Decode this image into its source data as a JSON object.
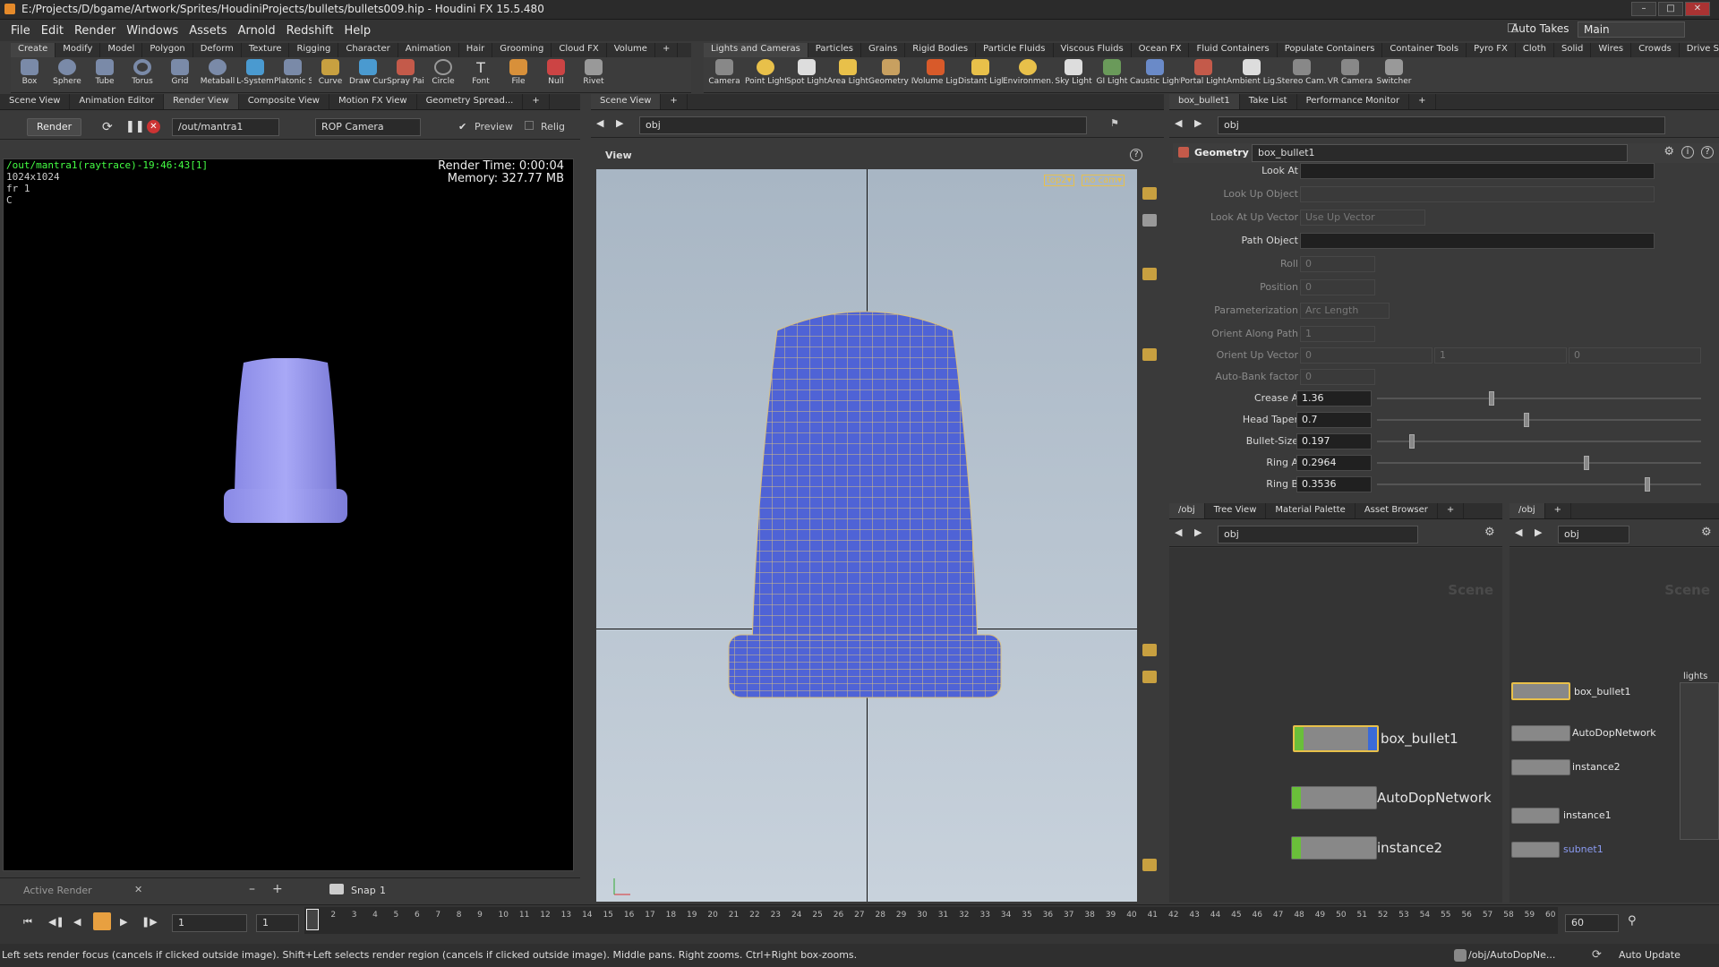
{
  "window": {
    "title": "E:/Projects/D/bgame/Artwork/Sprites/HoudiniProjects/bullets/bullets009.hip - Houdini FX 15.5.480"
  },
  "menu": [
    "File",
    "Edit",
    "Render",
    "Windows",
    "Assets",
    "Arnold",
    "Redshift",
    "Help"
  ],
  "top_right": {
    "auto_takes": "Auto Takes",
    "desktop": "Main"
  },
  "shelf_left": {
    "tabs": [
      "Create",
      "Modify",
      "Model",
      "Polygon",
      "Deform",
      "Texture",
      "Rigging",
      "Character",
      "Animation",
      "Hair",
      "Grooming",
      "Cloud FX",
      "Volume"
    ],
    "tools": [
      "Box",
      "Sphere",
      "Tube",
      "Torus",
      "Grid",
      "Metaball",
      "L-System",
      "Platonic Sol...",
      "Curve",
      "Draw Curve",
      "Spray Paint",
      "Circle",
      "Font",
      "File",
      "Null",
      "Rivet"
    ]
  },
  "shelf_right": {
    "tabs": [
      "Lights and Cameras",
      "Particles",
      "Grains",
      "Rigid Bodies",
      "Particle Fluids",
      "Viscous Fluids",
      "Ocean FX",
      "Fluid Containers",
      "Populate Containers",
      "Container Tools",
      "Pyro FX",
      "Cloth",
      "Solid",
      "Wires",
      "Crowds",
      "Drive Simulation"
    ],
    "tools": [
      "Camera",
      "Point Light",
      "Spot Light",
      "Area Light",
      "Geometry L...",
      "Volume Light",
      "Distant Light",
      "Environmen...",
      "Sky Light",
      "GI Light",
      "Caustic Light",
      "Portal Light",
      "Ambient Lig...",
      "Stereo Cam...",
      "VR Camera",
      "Switcher"
    ]
  },
  "left_panel": {
    "tabs": [
      "Scene View",
      "Animation Editor",
      "Render View",
      "Composite View",
      "Motion FX View",
      "Geometry Spread..."
    ],
    "render_btn": "Render",
    "rop_path": "/out/mantra1",
    "camera": "ROP Camera",
    "preview": "Preview",
    "relig": "Relig",
    "info_line1": "/out/mantra1(raytrace)-19:46:43[1]",
    "info_line2": "1024x1024",
    "info_line3": "fr 1",
    "info_line4": "C",
    "render_time": "Render Time: 0:00:04",
    "memory": "Memory:   327.77 MB",
    "active_render": "Active Render",
    "snap": "Snap",
    "snap_val": "1"
  },
  "mid_panel": {
    "tabs": [
      "Scene View"
    ],
    "path": "obj",
    "view_label": "View",
    "cam_menu1": "top2▾",
    "cam_menu2": "no cam▾"
  },
  "params": {
    "tabs": [
      "box_bullet1",
      "Take List",
      "Performance Monitor"
    ],
    "path": "obj",
    "type": "Geometry",
    "node": "box_bullet1",
    "rows": [
      {
        "label": "Look At",
        "value": "",
        "on": true
      },
      {
        "label": "Look Up Object",
        "value": "",
        "on": false
      },
      {
        "label": "Look At Up Vector",
        "value": "Use Up Vector",
        "on": false
      },
      {
        "label": "Path Object",
        "value": "",
        "on": true
      },
      {
        "label": "Roll",
        "value": "0",
        "on": false
      },
      {
        "label": "Position",
        "value": "0",
        "on": false
      },
      {
        "label": "Parameterization",
        "value": "Arc Length",
        "on": false
      },
      {
        "label": "Orient Along Path",
        "value": "1",
        "on": false
      },
      {
        "label": "Orient Up Vector",
        "value": "0",
        "on": false
      },
      {
        "label": "Auto-Bank factor",
        "value": "0",
        "on": false
      }
    ],
    "orient_up_vals": [
      "0",
      "1",
      "0"
    ],
    "sliders": [
      {
        "label": "Crease A",
        "value": "1.36",
        "level": 0.35
      },
      {
        "label": "Head Taper",
        "value": "0.7",
        "level": 0.46
      },
      {
        "label": "Bullet-Size",
        "value": "0.197",
        "level": 0.1
      },
      {
        "label": "Ring A",
        "value": "0.2964",
        "level": 0.65
      },
      {
        "label": "Ring B",
        "value": "0.3536",
        "level": 0.84
      }
    ]
  },
  "net1": {
    "tabs": [
      "/obj",
      "Tree View",
      "Material Palette",
      "Asset Browser"
    ],
    "path": "obj",
    "scene": "Scene",
    "nodes": [
      "box_bullet1",
      "AutoDopNetwork",
      "instance2"
    ]
  },
  "net2": {
    "tabs": [
      "/obj"
    ],
    "path": "obj",
    "scene": "Scene",
    "lights": "lights",
    "nodes": [
      "box_bullet1",
      "AutoDopNetwork",
      "instance2",
      "instance1",
      "subnet1"
    ]
  },
  "timeline": {
    "frame": "1",
    "start": "1",
    "end": "60",
    "ticks": [
      "1",
      "2",
      "3",
      "4",
      "5",
      "6",
      "7",
      "8",
      "9",
      "10",
      "11",
      "12",
      "13",
      "14",
      "15",
      "16",
      "17",
      "18",
      "19",
      "20",
      "21",
      "22",
      "23",
      "24",
      "25",
      "26",
      "27",
      "28",
      "29",
      "30",
      "31",
      "32",
      "33",
      "34",
      "35",
      "36",
      "37",
      "38",
      "39",
      "40",
      "41",
      "42",
      "43",
      "44",
      "45",
      "46",
      "47",
      "48",
      "49",
      "50",
      "51",
      "52",
      "53",
      "54",
      "55",
      "56",
      "57",
      "58",
      "59",
      "60"
    ]
  },
  "status": {
    "message": "Left sets render focus (cancels if clicked outside image). Shift+Left selects render region (cancels if clicked outside image). Middle pans. Right zooms. Ctrl+Right box-zooms.",
    "path": "/obj/AutoDopNe...",
    "update": "Auto Update"
  },
  "colors": {
    "accent": "#e8c04a",
    "node_green": "#6abf3a",
    "wire": "#d8c080",
    "mesh": "#4f63d6"
  }
}
